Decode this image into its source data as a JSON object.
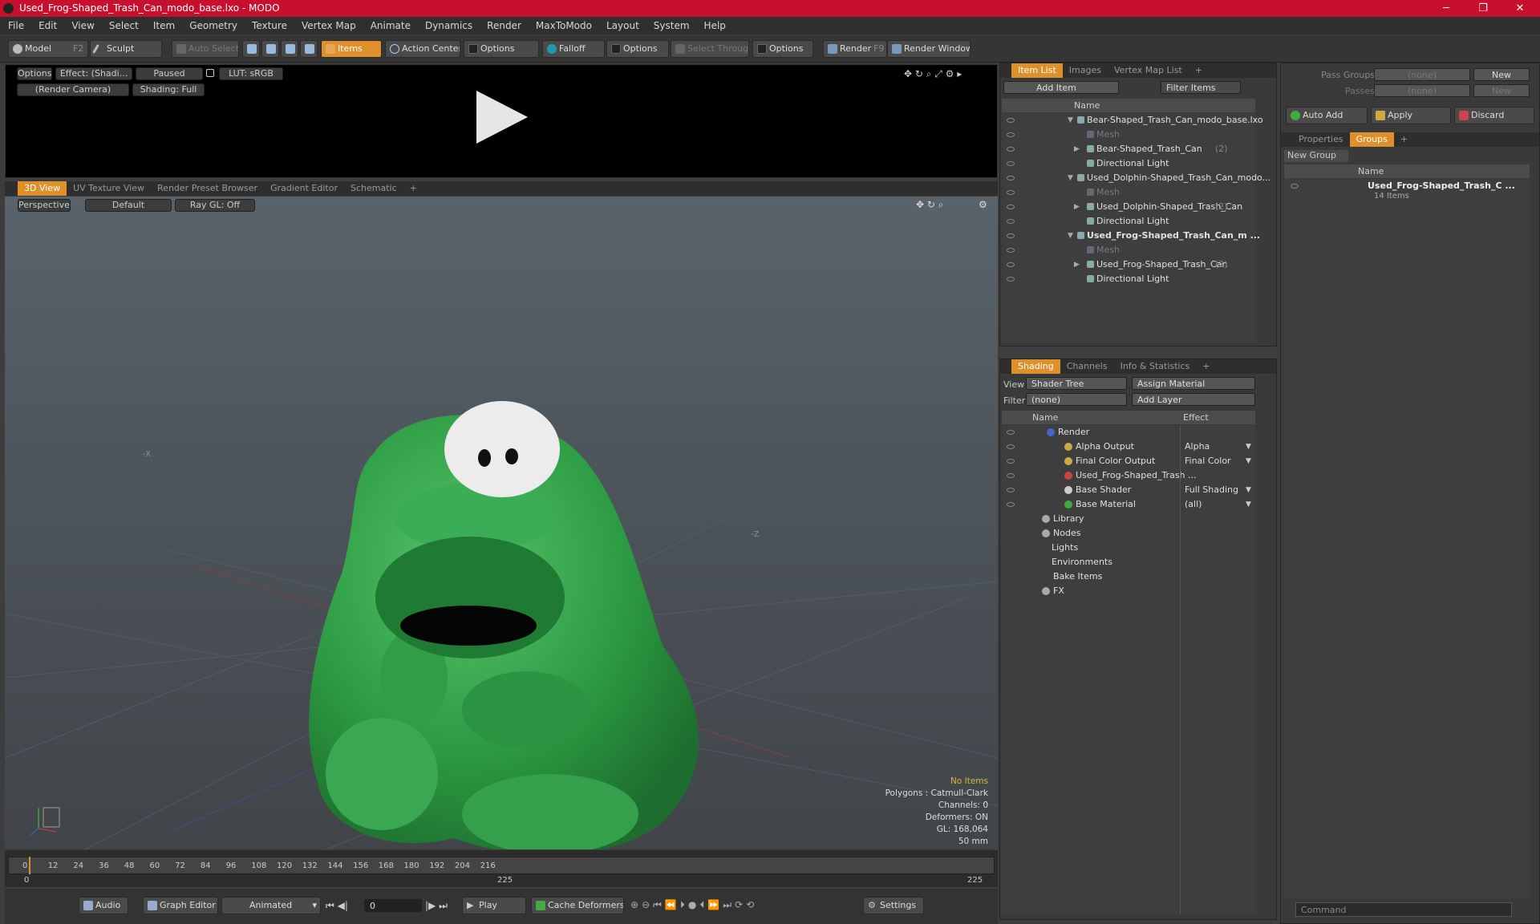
{
  "window": {
    "title": "Used_Frog-Shaped_Trash_Can_modo_base.lxo - MODO",
    "min": "─",
    "max": "❐",
    "close": "✕"
  },
  "menu": [
    "File",
    "Edit",
    "View",
    "Select",
    "Item",
    "Geometry",
    "Texture",
    "Vertex Map",
    "Animate",
    "Dynamics",
    "Render",
    "MaxToModo",
    "Layout",
    "System",
    "Help"
  ],
  "toolbar": {
    "model": "Model",
    "model_key": "F2",
    "sculpt": "Sculpt",
    "auto_select": "Auto Select",
    "items": "Items",
    "action_center": "Action Center",
    "options1": "Options",
    "falloff": "Falloff",
    "options2": "Options",
    "select_through": "Select Through",
    "options3": "Options",
    "render": "Render",
    "render_key": "F9",
    "render_window": "Render Window"
  },
  "render_preview": {
    "options": "Options",
    "effect": "Effect: (Shadi...",
    "paused": "Paused",
    "lut": "LUT: sRGB",
    "camera": "(Render Camera)",
    "shading": "Shading: Full"
  },
  "viewport_tabs": [
    "3D View",
    "UV Texture View",
    "Render Preset Browser",
    "Gradient Editor",
    "Schematic",
    "+"
  ],
  "viewport": {
    "perspective": "Perspective",
    "default": "Default",
    "raygl": "Ray GL: Off",
    "no_items": "No Items",
    "polygons": "Polygons : Catmull-Clark",
    "channels": "Channels: 0",
    "deformers": "Deformers: ON",
    "gl": "GL: 168,064",
    "size": "50 mm",
    "axis_x": "-X",
    "axis_z": "-Z"
  },
  "timeline": {
    "ticks": [
      "0",
      "12",
      "24",
      "36",
      "48",
      "60",
      "72",
      "84",
      "96",
      "108",
      "120",
      "132",
      "144",
      "156",
      "168",
      "180",
      "192",
      "204",
      "216"
    ],
    "start": "0",
    "mid": "225",
    "end": "225"
  },
  "bottombar": {
    "audio": "Audio",
    "graph_editor": "Graph Editor",
    "animated": "Animated",
    "frame": "0",
    "play": "Play",
    "cache": "Cache Deformers",
    "settings": "Settings"
  },
  "itemlist": {
    "tabs": [
      "Item List",
      "Images",
      "Vertex Map List",
      "+"
    ],
    "add_item": "Add Item",
    "filter": "Filter Items",
    "col_name": "Name",
    "rows": [
      {
        "label": "Bear-Shaped_Trash_Can_modo_base.lxo",
        "indent": 0,
        "bold": false,
        "dim": false,
        "count": ""
      },
      {
        "label": "Mesh",
        "indent": 1,
        "bold": false,
        "dim": true,
        "count": ""
      },
      {
        "label": "Bear-Shaped_Trash_Can",
        "indent": 1,
        "bold": false,
        "dim": false,
        "count": "(2)"
      },
      {
        "label": "Directional Light",
        "indent": 1,
        "bold": false,
        "dim": false,
        "count": ""
      },
      {
        "label": "Used_Dolphin-Shaped_Trash_Can_modo...",
        "indent": 0,
        "bold": false,
        "dim": false,
        "count": ""
      },
      {
        "label": "Mesh",
        "indent": 1,
        "bold": false,
        "dim": true,
        "count": ""
      },
      {
        "label": "Used_Dolphin-Shaped_Trash_Can",
        "indent": 1,
        "bold": false,
        "dim": false,
        "count": "(2)"
      },
      {
        "label": "Directional Light",
        "indent": 1,
        "bold": false,
        "dim": false,
        "count": ""
      },
      {
        "label": "Used_Frog-Shaped_Trash_Can_m ...",
        "indent": 0,
        "bold": true,
        "dim": false,
        "count": ""
      },
      {
        "label": "Mesh",
        "indent": 1,
        "bold": false,
        "dim": true,
        "count": ""
      },
      {
        "label": "Used_Frog-Shaped_Trash_Can",
        "indent": 1,
        "bold": false,
        "dim": false,
        "count": "(2)"
      },
      {
        "label": "Directional Light",
        "indent": 1,
        "bold": false,
        "dim": false,
        "count": ""
      }
    ]
  },
  "shading": {
    "tabs": [
      "Shading",
      "Channels",
      "Info & Statistics",
      "+"
    ],
    "view_label": "View",
    "view": "Shader Tree",
    "assign": "Assign Material",
    "filter_label": "Filter",
    "filter": "(none)",
    "add_layer": "Add Layer",
    "col_name": "Name",
    "col_effect": "Effect",
    "rows": [
      {
        "label": "Render",
        "effect": ""
      },
      {
        "label": "Alpha Output",
        "effect": "Alpha"
      },
      {
        "label": "Final Color Output",
        "effect": "Final Color"
      },
      {
        "label": "Used_Frog-Shaped_Trash ...",
        "effect": ""
      },
      {
        "label": "Base Shader",
        "effect": "Full Shading"
      },
      {
        "label": "Base Material",
        "effect": "(all)"
      },
      {
        "label": "Library",
        "effect": ""
      },
      {
        "label": "Nodes",
        "effect": ""
      },
      {
        "label": "Lights",
        "effect": ""
      },
      {
        "label": "Environments",
        "effect": ""
      },
      {
        "label": "Bake Items",
        "effect": ""
      },
      {
        "label": "FX",
        "effect": ""
      }
    ]
  },
  "right": {
    "pass_groups": "Pass Groups",
    "passes": "Passes",
    "none1": "(none)",
    "none2": "(none)",
    "new1": "New",
    "new2": "New",
    "auto_add": "Auto Add",
    "apply": "Apply",
    "discard": "Discard",
    "tabs": [
      "Properties",
      "Groups",
      "+"
    ],
    "new_group": "New Group",
    "col_name": "Name",
    "group_name": "Used_Frog-Shaped_Trash_C ...",
    "group_count": "14 Items",
    "command": "Command"
  }
}
